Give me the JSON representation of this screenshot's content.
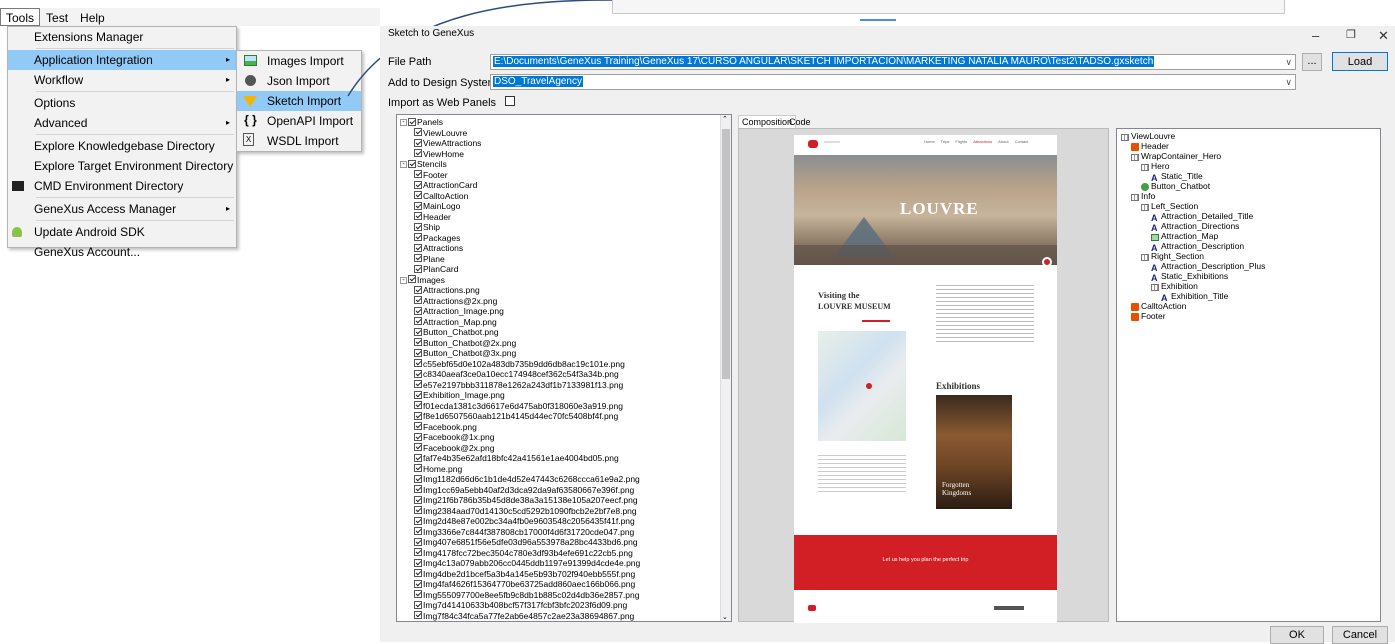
{
  "menubar": {
    "items": [
      "Tools",
      "Test",
      "Help"
    ]
  },
  "tools_menu": {
    "items": [
      {
        "label": "Extensions Manager",
        "icon": "",
        "arrow": false
      },
      {
        "label": "Application Integration",
        "icon": "",
        "arrow": true,
        "highlight": true
      },
      {
        "label": "Workflow",
        "icon": "",
        "arrow": true
      },
      {
        "label": "Options",
        "icon": "",
        "arrow": false
      },
      {
        "label": "Advanced",
        "icon": "",
        "arrow": true
      },
      {
        "label": "Explore Knowledgebase Directory",
        "icon": "",
        "arrow": false
      },
      {
        "label": "Explore Target Environment Directory",
        "icon": "",
        "arrow": false
      },
      {
        "label": "CMD Environment Directory",
        "icon": "cmd-icon",
        "arrow": false
      },
      {
        "label": "GeneXus Access Manager",
        "icon": "",
        "arrow": true
      },
      {
        "label": "Update Android SDK",
        "icon": "android-icon",
        "arrow": false
      },
      {
        "label": "GeneXus Account...",
        "icon": "",
        "arrow": false
      }
    ]
  },
  "submenu": {
    "items": [
      {
        "label": "Images Import",
        "icon": "image-icon"
      },
      {
        "label": "Json Import",
        "icon": "json-icon"
      },
      {
        "label": "Sketch Import",
        "icon": "sketch-icon",
        "highlight": true
      },
      {
        "label": "OpenAPI Import",
        "icon": "openapi-icon"
      },
      {
        "label": "WSDL Import",
        "icon": "wsdl-icon"
      }
    ]
  },
  "dialog": {
    "title": "Sketch to GeneXus",
    "file_path_label": "File Path",
    "file_path_value": "E:\\Documents\\GeneXus Training\\GeneXus 17\\CURSO ANGULAR\\SKETCH IMPORTACION\\MARKETING NATALIA MAURO\\Test2\\TADSO.gxsketch",
    "browse_label": "...",
    "load_label": "Load",
    "design_system_label": "Add to Design System",
    "design_system_value": "DSO_TravelAgency",
    "web_panels_label": "Import as Web Panels",
    "ok_label": "OK",
    "cancel_label": "Cancel",
    "tabs": [
      "Composition",
      "Code"
    ]
  },
  "left_tree": [
    {
      "level": 0,
      "label": "Panels",
      "exp": true
    },
    {
      "level": 1,
      "label": "ViewLouvre"
    },
    {
      "level": 1,
      "label": "ViewAttractions"
    },
    {
      "level": 1,
      "label": "ViewHome"
    },
    {
      "level": 0,
      "label": "Stencils",
      "exp": true
    },
    {
      "level": 1,
      "label": "Footer"
    },
    {
      "level": 1,
      "label": "AttractionCard"
    },
    {
      "level": 1,
      "label": "CalltoAction"
    },
    {
      "level": 1,
      "label": "MainLogo"
    },
    {
      "level": 1,
      "label": "Header"
    },
    {
      "level": 1,
      "label": "Ship"
    },
    {
      "level": 1,
      "label": "Packages"
    },
    {
      "level": 1,
      "label": "Attractions"
    },
    {
      "level": 1,
      "label": "Plane"
    },
    {
      "level": 1,
      "label": "PlanCard"
    },
    {
      "level": 0,
      "label": "Images",
      "exp": true
    },
    {
      "level": 1,
      "label": "Attractions.png"
    },
    {
      "level": 1,
      "label": "Attractions@2x.png"
    },
    {
      "level": 1,
      "label": "Attraction_Image.png"
    },
    {
      "level": 1,
      "label": "Attraction_Map.png"
    },
    {
      "level": 1,
      "label": "Button_Chatbot.png"
    },
    {
      "level": 1,
      "label": "Button_Chatbot@2x.png"
    },
    {
      "level": 1,
      "label": "Button_Chatbot@3x.png"
    },
    {
      "level": 1,
      "label": "c55ebf65d0e102a483db735b9dd6db8ac19c101e.png"
    },
    {
      "level": 1,
      "label": "c8340aeaf3ce0a10ecc174948cef362c54f3a34b.png"
    },
    {
      "level": 1,
      "label": "e57e2197bbb311878e1262a243df1b7133981f13.png"
    },
    {
      "level": 1,
      "label": "Exhibition_Image.png"
    },
    {
      "level": 1,
      "label": "f01ecda1381c3d6617e6d475ab0f318060e3a919.png"
    },
    {
      "level": 1,
      "label": "f8e1d6507560aab121b4145d44ec70fc5408bf4f.png"
    },
    {
      "level": 1,
      "label": "Facebook.png"
    },
    {
      "level": 1,
      "label": "Facebook@1x.png"
    },
    {
      "level": 1,
      "label": "Facebook@2x.png"
    },
    {
      "level": 1,
      "label": "faf7e4b35e62afd18bfc42a41561e1ae4004bd05.png"
    },
    {
      "level": 1,
      "label": "Home.png"
    },
    {
      "level": 1,
      "label": "Img1182d66d6c1b1de4d52e47443c6268ccca61e9a2.png"
    },
    {
      "level": 1,
      "label": "Img1cc69a5ebb40af2d3dca92da9af63580667e396f.png"
    },
    {
      "level": 1,
      "label": "Img21f6b786b35b45d8de38a3a15138e105a207eecf.png"
    },
    {
      "level": 1,
      "label": "Img2384aad70d14130c5cd5292b1090fbcb2e2bf7e8.png"
    },
    {
      "level": 1,
      "label": "Img2d48e87e002bc34a4fb0e9603548c2056435f41f.png"
    },
    {
      "level": 1,
      "label": "Img3366e7c844f387808cb17000f4d6f31720cde047.png"
    },
    {
      "level": 1,
      "label": "Img407e6851f56e5dfe03d96a553978a28bc4433bd6.png"
    },
    {
      "level": 1,
      "label": "Img4178fcc72bec3504c780e3df93b4efe691c22cb5.png"
    },
    {
      "level": 1,
      "label": "Img4c13a079abb206cc0445ddb1197e91399d4cde4e.png"
    },
    {
      "level": 1,
      "label": "Img4dbe2d1bcef5a3b4a145e5b93b702f940ebb555f.png"
    },
    {
      "level": 1,
      "label": "Img4faf4626f15364770be63725add860aec166b066.png"
    },
    {
      "level": 1,
      "label": "Img555097700e8ee5fb9c8db1b885c02d4db36e2857.png"
    },
    {
      "level": 1,
      "label": "Img7d41410633b408bcf57f317fcbf3bfc2023f6d09.png"
    },
    {
      "level": 1,
      "label": "Img7f84c34fca5a77fe2ab6e4857c2ae23a38694867.png"
    }
  ],
  "right_tree": [
    {
      "level": 0,
      "label": "ViewLouvre",
      "icon": "table"
    },
    {
      "level": 1,
      "label": "Header",
      "icon": "stencil"
    },
    {
      "level": 1,
      "label": "WrapContainer_Hero",
      "icon": "table"
    },
    {
      "level": 2,
      "label": "Hero",
      "icon": "table"
    },
    {
      "level": 3,
      "label": "Static_Title",
      "icon": "text"
    },
    {
      "level": 2,
      "label": "Button_Chatbot",
      "icon": "button"
    },
    {
      "level": 1,
      "label": "Info",
      "icon": "table"
    },
    {
      "level": 2,
      "label": "Left_Section",
      "icon": "table"
    },
    {
      "level": 3,
      "label": "Attraction_Detailed_Title",
      "icon": "text"
    },
    {
      "level": 3,
      "label": "Attraction_Directions",
      "icon": "text"
    },
    {
      "level": 3,
      "label": "Attraction_Map",
      "icon": "image"
    },
    {
      "level": 3,
      "label": "Attraction_Description",
      "icon": "text"
    },
    {
      "level": 2,
      "label": "Right_Section",
      "icon": "table"
    },
    {
      "level": 3,
      "label": "Attraction_Description_Plus",
      "icon": "text"
    },
    {
      "level": 3,
      "label": "Static_Exhibitions",
      "icon": "text"
    },
    {
      "level": 3,
      "label": "Exhibition",
      "icon": "table"
    },
    {
      "level": 4,
      "label": "Exhibition_Title",
      "icon": "text"
    },
    {
      "level": 1,
      "label": "CalltoAction",
      "icon": "stencil"
    },
    {
      "level": 1,
      "label": "Footer",
      "icon": "stencil"
    }
  ],
  "preview": {
    "nav": [
      "Home",
      "Trips",
      "Flights",
      "Attractions",
      "About",
      "Contact"
    ],
    "hero_title": "LOUVRE",
    "visiting": "Visiting the",
    "museum": "LOUVRE MUSEUM",
    "exhibitions": "Exhibitions",
    "exhibition_title": "Forgotten Kingdoms",
    "cta": "Let us help you plan the perfect trip"
  },
  "colors": {
    "accent": "#0078d7",
    "menu_highlight": "#91c9f7",
    "brand_red": "#d21f26"
  }
}
